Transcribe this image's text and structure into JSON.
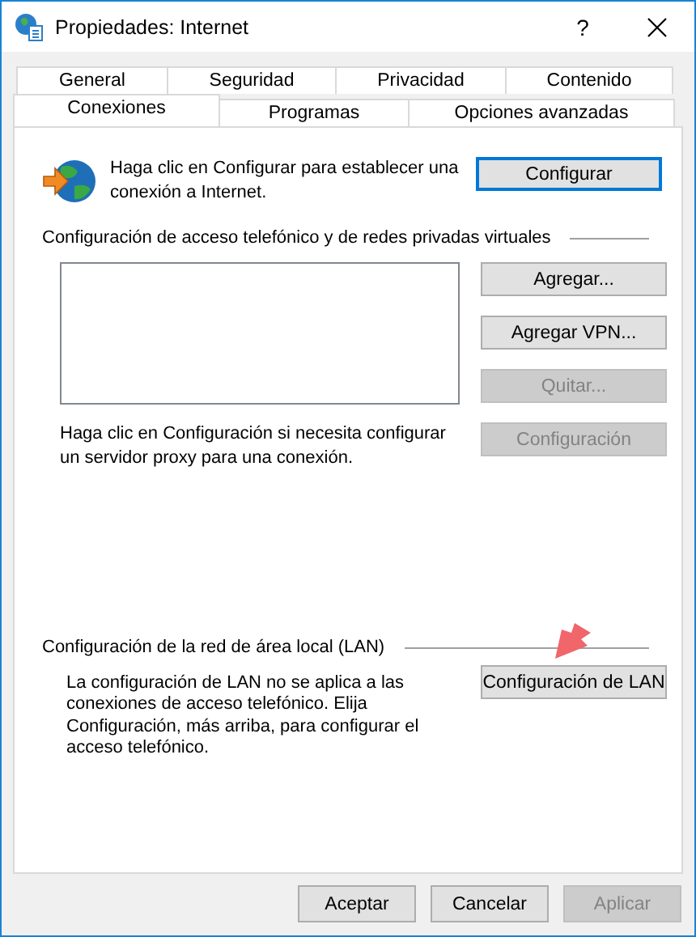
{
  "window": {
    "title": "Propiedades: Internet",
    "help": "?"
  },
  "tab_rows": [
    {
      "tabs": [
        {
          "label": "General",
          "selected": false
        },
        {
          "label": "Seguridad",
          "selected": false
        },
        {
          "label": "Privacidad",
          "selected": false
        },
        {
          "label": "Contenido",
          "selected": false
        }
      ]
    },
    {
      "tabs": [
        {
          "label": "Conexiones",
          "selected": true
        },
        {
          "label": "Programas",
          "selected": false
        },
        {
          "label": "Opciones avanzadas",
          "selected": false
        }
      ]
    }
  ],
  "setup": {
    "text": "Haga clic en Configurar para establecer una conexión a Internet.",
    "button": {
      "label": "Configurar",
      "disabled": false,
      "focused": true
    }
  },
  "dialup": {
    "heading": "Configuración de acceso telefónico y de redes privadas virtuales",
    "buttons": [
      {
        "label": "Agregar...",
        "disabled": false
      },
      {
        "label": "Agregar VPN...",
        "disabled": false
      },
      {
        "label": "Quitar...",
        "disabled": true
      }
    ],
    "proxy_text": "Haga clic en Configuración si necesita configurar un servidor proxy para una conexión.",
    "settings_button": {
      "label": "Configuración",
      "disabled": true
    }
  },
  "lan": {
    "heading": "Configuración de la red de área local (LAN)",
    "text": "La configuración de LAN no se aplica a las conexiones de acceso telefónico. Elija Configuración, más arriba, para configurar el acceso telefónico.",
    "button": {
      "label": "Configuración de LAN",
      "disabled": false
    }
  },
  "footer": [
    {
      "label": "Aceptar",
      "disabled": false
    },
    {
      "label": "Cancelar",
      "disabled": false
    },
    {
      "label": "Aplicar",
      "disabled": true
    }
  ]
}
